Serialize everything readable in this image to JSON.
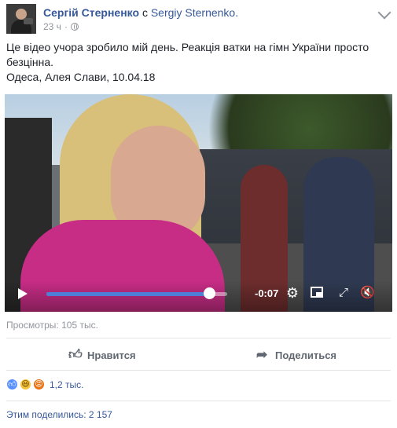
{
  "post": {
    "author_name": "Сергій Стерненко",
    "with_word": "с",
    "tagged_name": "Sergiy Sternenko.",
    "time": "23 ч",
    "text_line1": "Це відео учора зробило мій день. Реакція ватки на гімн України просто безцінна.",
    "text_line2": "Одеса, Алея Слави, 10.04.18"
  },
  "video": {
    "time_remaining": "-0:07",
    "progress": 0.9
  },
  "stats": {
    "views": "Просмотры: 105 тыс.",
    "reactions_count": "1,2 тыс.",
    "shares": "Этим поделились: 2 157"
  },
  "actions": {
    "like_label": "Нравится",
    "share_label": "Поделиться"
  },
  "colors": {
    "link": "#365899",
    "accent_blue": "#4e7fd6"
  }
}
